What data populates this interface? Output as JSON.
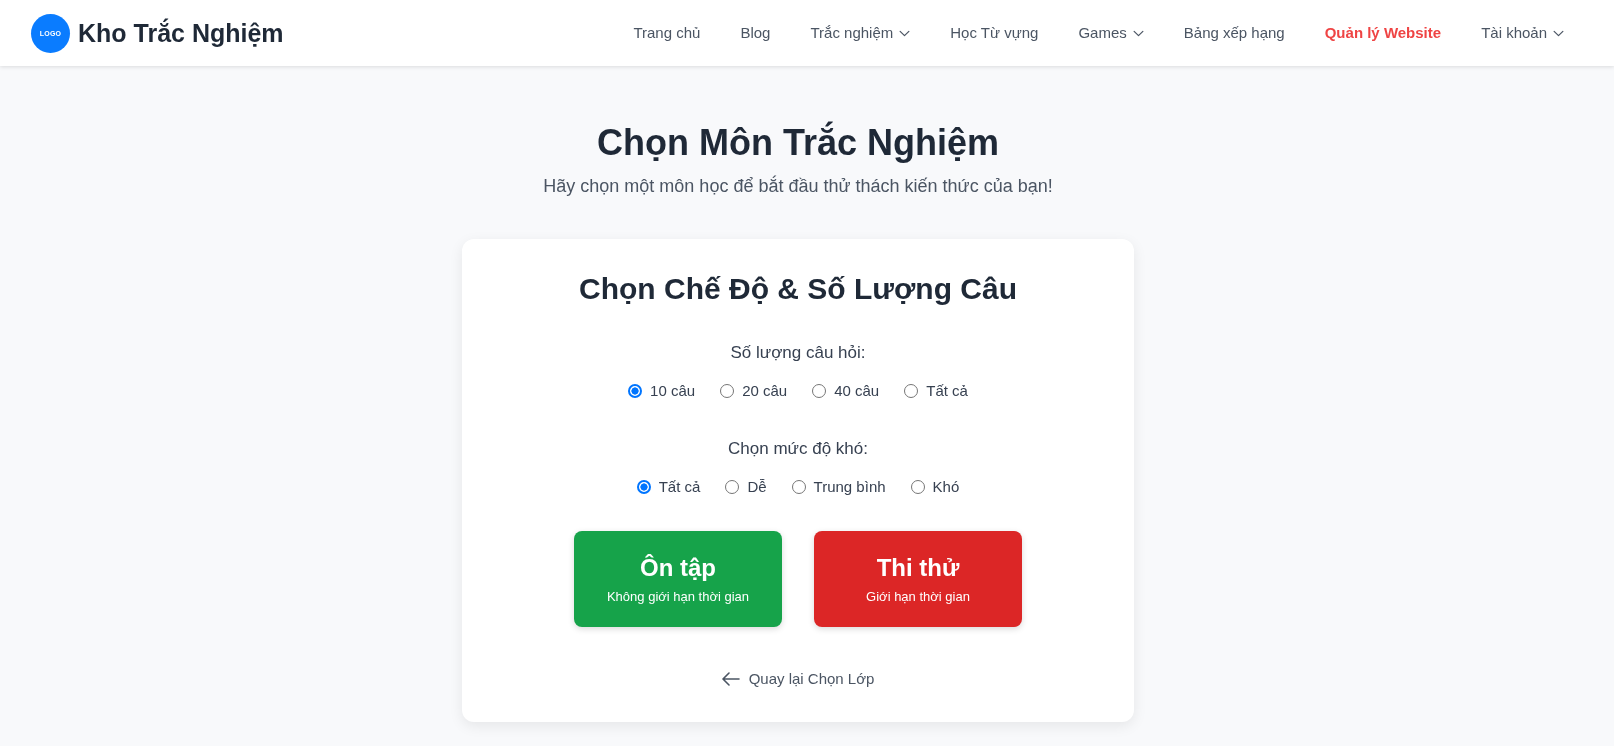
{
  "header": {
    "logo_text": "LOGO",
    "brand": "Kho Trắc Nghiệm",
    "nav": [
      {
        "label": "Trang chủ",
        "kind": "link"
      },
      {
        "label": "Blog",
        "kind": "link"
      },
      {
        "label": "Trắc nghiệm",
        "kind": "menu"
      },
      {
        "label": "Học Từ vựng",
        "kind": "link"
      },
      {
        "label": "Games",
        "kind": "menu"
      },
      {
        "label": "Bảng xếp hạng",
        "kind": "link"
      },
      {
        "label": "Quản lý Website",
        "kind": "accent"
      },
      {
        "label": "Tài khoản",
        "kind": "menu"
      }
    ]
  },
  "page": {
    "title": "Chọn Môn Trắc Nghiệm",
    "subtitle": "Hãy chọn một môn học để bắt đầu thử thách kiến thức của bạn!"
  },
  "card": {
    "heading": "Chọn Chế Độ & Số Lượng Câu",
    "groups": [
      {
        "label": "Số lượng câu hỏi:",
        "options": [
          {
            "label": "10 câu",
            "selected": true
          },
          {
            "label": "20 câu",
            "selected": false
          },
          {
            "label": "40 câu",
            "selected": false
          },
          {
            "label": "Tất cả",
            "selected": false
          }
        ]
      },
      {
        "label": "Chọn mức độ khó:",
        "options": [
          {
            "label": "Tất cả",
            "selected": true
          },
          {
            "label": "Dễ",
            "selected": false
          },
          {
            "label": "Trung bình",
            "selected": false
          },
          {
            "label": "Khó",
            "selected": false
          }
        ]
      }
    ],
    "modes": [
      {
        "title": "Ôn tập",
        "subtitle": "Không giới hạn thời gian",
        "color": "#16a34a"
      },
      {
        "title": "Thi thử",
        "subtitle": "Giới hạn thời gian",
        "color": "#dc2626"
      }
    ],
    "back_link": "Quay lại Chọn Lớp"
  }
}
